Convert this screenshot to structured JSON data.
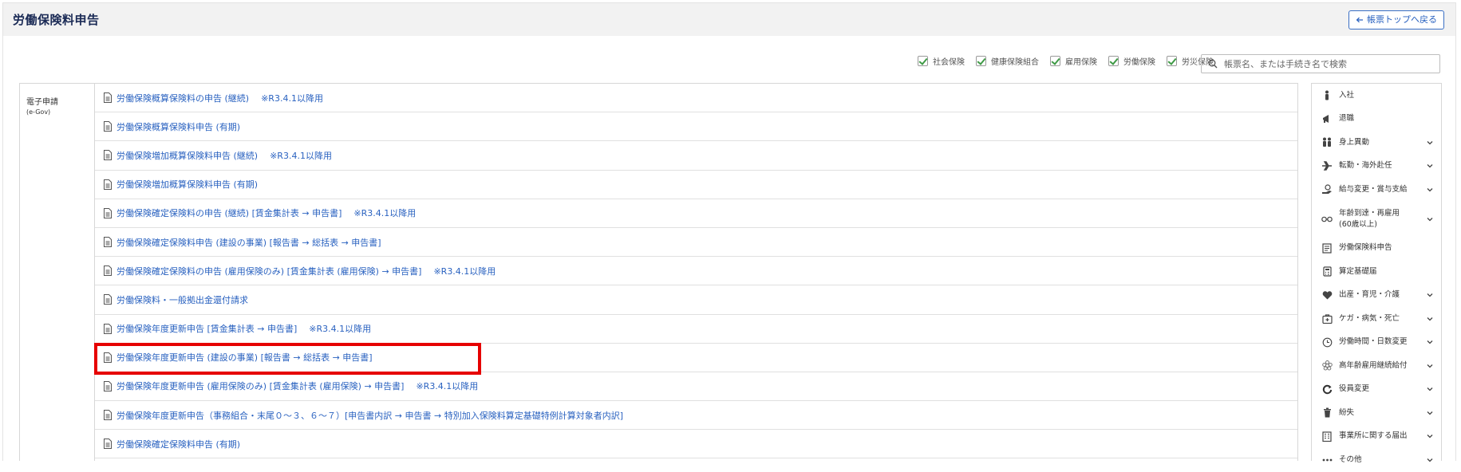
{
  "header": {
    "title": "労働保険料申告",
    "back_button": "帳票トップへ戻る"
  },
  "filters": [
    {
      "label": "社会保険",
      "checked": true
    },
    {
      "label": "健康保険組合",
      "checked": true
    },
    {
      "label": "雇用保険",
      "checked": true
    },
    {
      "label": "労働保険",
      "checked": true
    },
    {
      "label": "労災保険",
      "checked": true
    }
  ],
  "search": {
    "placeholder": "帳票名、または手続き名で検索"
  },
  "category": {
    "name": "電子申請",
    "sub": "(e-Gov)"
  },
  "forms": [
    {
      "title": "労働保険概算保険料の申告 (継続)",
      "note": "※R3.4.1以降用"
    },
    {
      "title": "労働保険概算保険料申告 (有期)",
      "note": ""
    },
    {
      "title": "労働保険増加概算保険料申告 (継続)",
      "note": "※R3.4.1以降用"
    },
    {
      "title": "労働保険増加概算保険料申告 (有期)",
      "note": ""
    },
    {
      "title": "労働保険確定保険料の申告 (継続) [賃金集計表 → 申告書]",
      "note": "※R3.4.1以降用"
    },
    {
      "title": "労働保険確定保険料申告 (建設の事業) [報告書 → 総括表 → 申告書]",
      "note": ""
    },
    {
      "title": "労働保険確定保険料の申告 (雇用保険のみ) [賃金集計表 (雇用保険) → 申告書]",
      "note": "※R3.4.1以降用"
    },
    {
      "title": "労働保険料・一般拠出金還付請求",
      "note": ""
    },
    {
      "title": "労働保険年度更新申告 [賃金集計表 → 申告書]",
      "note": "※R3.4.1以降用"
    },
    {
      "title": "労働保険年度更新申告 (建設の事業) [報告書 → 総括表 → 申告書]",
      "note": ""
    },
    {
      "title": "労働保険年度更新申告 (雇用保険のみ) [賃金集計表 (雇用保険) → 申告書]",
      "note": "※R3.4.1以降用"
    },
    {
      "title": "労働保険年度更新申告（事務組合・末尾０～３、６～７）[申告書内訳 → 申告書 → 特別加入保険料算定基礎特例計算対象者内訳]",
      "note": ""
    },
    {
      "title": "労働保険確定保険料申告 (有期)",
      "note": ""
    }
  ],
  "sidebar": [
    {
      "label": "入社",
      "icon": "person-icon",
      "expandable": false
    },
    {
      "label": "退職",
      "icon": "megaphone-icon",
      "expandable": false
    },
    {
      "label": "身上異動",
      "icon": "people-icon",
      "expandable": true
    },
    {
      "label": "転勤・海外赴任",
      "icon": "airplane-icon",
      "expandable": true
    },
    {
      "label": "給与変更・賞与支給",
      "icon": "money-hand-icon",
      "expandable": true
    },
    {
      "label": "年齢到達・再雇用\n(60歳以上)",
      "icon": "glasses-icon",
      "expandable": true
    },
    {
      "label": "労働保険料申告",
      "icon": "document-icon",
      "expandable": false
    },
    {
      "label": "算定基礎届",
      "icon": "calculator-icon",
      "expandable": false
    },
    {
      "label": "出産・育児・介護",
      "icon": "heart-icon",
      "expandable": true
    },
    {
      "label": "ケガ・病気・死亡",
      "icon": "first-aid-icon",
      "expandable": true
    },
    {
      "label": "労働時間・日数変更",
      "icon": "clock-icon",
      "expandable": true
    },
    {
      "label": "高年齢雇用継続給付",
      "icon": "flower-icon",
      "expandable": true
    },
    {
      "label": "役員変更",
      "icon": "refresh-icon",
      "expandable": true
    },
    {
      "label": "紛失",
      "icon": "trash-icon",
      "expandable": true
    },
    {
      "label": "事業所に関する届出",
      "icon": "building-icon",
      "expandable": true
    },
    {
      "label": "その他",
      "icon": "more-icon",
      "expandable": true
    }
  ],
  "colors": {
    "link": "#2a62c0",
    "highlight": "#e60000",
    "check": "#3f9a46"
  }
}
